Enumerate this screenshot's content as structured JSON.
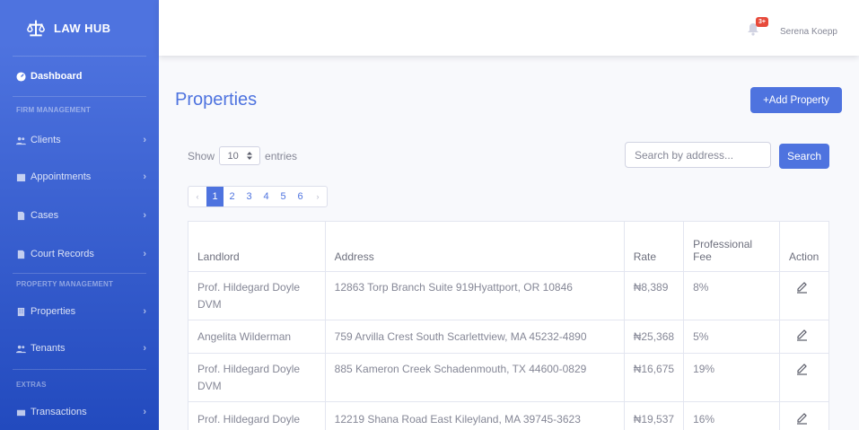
{
  "brand": {
    "name": "LAW HUB"
  },
  "sidebar": {
    "dashboard": "Dashboard",
    "headings": {
      "firm": "FIRM MANAGEMENT",
      "property": "PROPERTY MANAGEMENT",
      "extras": "EXTRAS"
    },
    "items": {
      "clients": "Clients",
      "appointments": "Appointments",
      "cases": "Cases",
      "court_records": "Court Records",
      "properties": "Properties",
      "tenants": "Tenants",
      "transactions": "Transactions"
    },
    "chevron": "›"
  },
  "topbar": {
    "alert_count": "3+",
    "user_name": "Serena Koepp"
  },
  "page": {
    "title": "Properties",
    "add_button": "+Add Property"
  },
  "controls": {
    "show_label": "Show",
    "entries_value": "10",
    "entries_label": "entries",
    "search_placeholder": "Search by address...",
    "search_button": "Search"
  },
  "pagination": {
    "prev": "‹",
    "next": "›",
    "pages": [
      "1",
      "2",
      "3",
      "4",
      "5",
      "6"
    ],
    "active": "1"
  },
  "table": {
    "headers": {
      "landlord": "Landlord",
      "address": "Address",
      "rate": "Rate",
      "fee_line1": "Professional",
      "fee_line2": "Fee",
      "action": "Action"
    },
    "rows": [
      {
        "landlord_line1": "Prof. Hildegard Doyle",
        "landlord_line2": "DVM",
        "address": "12863 Torp Branch Suite 919Hyattport, OR 10846",
        "rate": "₦8,389",
        "fee": "8%"
      },
      {
        "landlord_line1": "Angelita Wilderman",
        "landlord_line2": "",
        "address": "759 Arvilla Crest South Scarlettview, MA 45232-4890",
        "rate": "₦25,368",
        "fee": "5%"
      },
      {
        "landlord_line1": "Prof. Hildegard Doyle",
        "landlord_line2": "DVM",
        "address": "885 Kameron Creek Schadenmouth, TX 44600-0829",
        "rate": "₦16,675",
        "fee": "19%"
      },
      {
        "landlord_line1": "Prof. Hildegard Doyle",
        "landlord_line2": "",
        "address": "12219 Shana Road East Kileyland, MA 39745-3623",
        "rate": "₦19,537",
        "fee": "16%"
      }
    ]
  },
  "colors": {
    "primary": "#4e73df",
    "sidebar_dark": "#224abe",
    "danger": "#e74a3b",
    "text_muted": "#858796"
  },
  "icons": [
    "scales-logo-icon",
    "dashboard-icon",
    "users-icon",
    "calendar-icon",
    "file-icon",
    "building-icon",
    "money-icon",
    "bell-icon",
    "pencil-icon",
    "chevron-right-icon",
    "sort-arrows-icon"
  ]
}
